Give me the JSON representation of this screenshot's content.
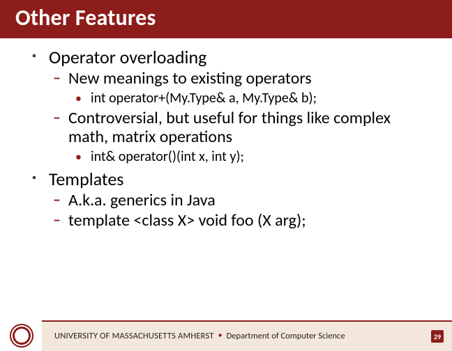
{
  "title": "Other Features",
  "bullets": {
    "b1": "Operator overloading",
    "b1_1": "New meanings to existing operators",
    "b1_1_1": "int operator+(My.Type& a, My.Type& b);",
    "b1_2": "Controversial, but useful for things like complex math, matrix operations",
    "b1_2_1": "int& operator()(int x, int y);",
    "b2": "Templates",
    "b2_1": "A.k.a. generics in Java",
    "b2_2": "template <class X> void foo (X arg);"
  },
  "footer": {
    "university": "UNIVERSITY OF MASSACHUSETTS AMHERST",
    "separator": "•",
    "department": "Department of Computer Science"
  },
  "page_number": "29"
}
